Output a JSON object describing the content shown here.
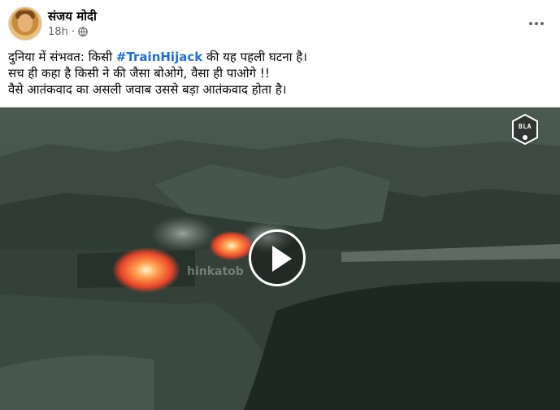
{
  "post": {
    "author": "संजय मोदी",
    "time": "18h",
    "audience_icon": "globe-icon",
    "more_icon": "more-options-icon",
    "text_lines": [
      "दुनिया में संभवत: किसी",
      "#TrainHijack",
      "की यह पहली घटना है।",
      "सच ही कहा है किसी ने की जैसा बोओगे, वैसा ही पाओगे !!",
      "वैसे आतंकवाद का असली जवाब उससे बड़ा आतंकवाद होता है।"
    ]
  },
  "video": {
    "badge_text": "BLA",
    "site_watermark": "hinkatob",
    "play_icon": "play-icon",
    "colors": {
      "sky": "#3f4c45",
      "hills": "#2f3d35",
      "fire": "#ff6a2a",
      "smoke": "#aab7b4"
    }
  },
  "colors": {
    "hashtag": "#216fdb",
    "secondary_text": "#65676b"
  }
}
